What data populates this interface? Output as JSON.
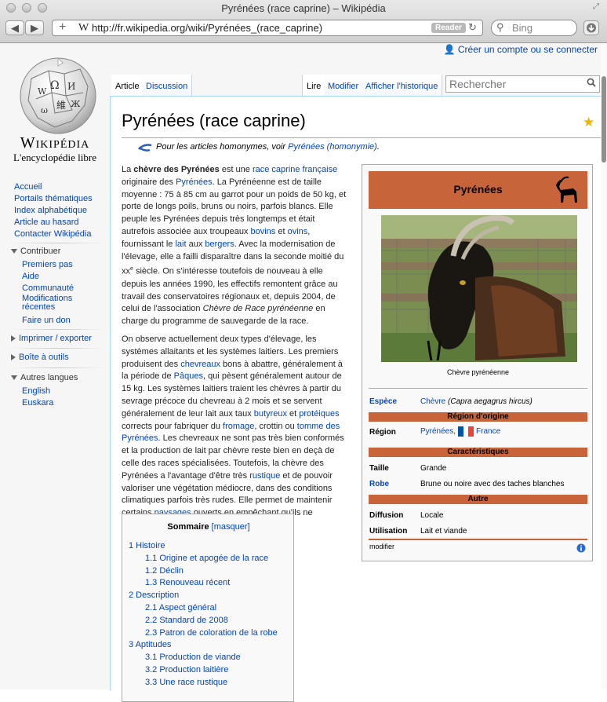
{
  "browser": {
    "window_title": "Pyrénées (race caprine) – Wikipédia",
    "url": "http://fr.wikipedia.org/wiki/Pyrénées_(race_caprine)",
    "reader_label": "Reader",
    "search_placeholder": "Bing"
  },
  "logo": {
    "title": "Wikipédia",
    "subtitle": "L'encyclopédie libre"
  },
  "sidebar": {
    "nav": [
      "Accueil",
      "Portails thématiques",
      "Index alphabétique",
      "Article au hasard",
      "Contacter Wikipédia"
    ],
    "contribuer": {
      "label": "Contribuer",
      "items": [
        "Premiers pas",
        "Aide",
        "Communauté",
        "Modifications récentes",
        "Faire un don"
      ]
    },
    "imprimer": "Imprimer / exporter",
    "outils": "Boîte à outils",
    "langues": {
      "label": "Autres langues",
      "items": [
        "English",
        "Euskara"
      ]
    }
  },
  "personal": {
    "create_account": "Créer un compte ou se connecter"
  },
  "tabs": {
    "article": "Article",
    "discussion": "Discussion",
    "lire": "Lire",
    "modifier": "Modifier",
    "historique": "Afficher l'historique"
  },
  "search": {
    "placeholder": "Rechercher"
  },
  "article": {
    "title": "Pyrénées (race caprine)",
    "hatnote_prefix": "Pour les articles homonymes, voir ",
    "hatnote_link": "Pyrénées (homonymie)",
    "hatnote_suffix": "."
  },
  "infobox": {
    "title": "Pyrénées",
    "caption": "Chèvre pyrénéenne",
    "espece_label": "Espèce",
    "espece_link": "Chèvre",
    "espece_sci": "(Capra aegagrus hircus)",
    "region_head": "Région d'origine",
    "region_label": "Région",
    "region_link": "Pyrénées,",
    "region_country": "France",
    "carac_head": "Caractéristiques",
    "taille_label": "Taille",
    "taille_val": "Grande",
    "robe_label": "Robe",
    "robe_val": "Brune ou noire avec des taches blanches",
    "autre_head": "Autre",
    "diffusion_label": "Diffusion",
    "diffusion_val": "Locale",
    "utilisation_label": "Utilisation",
    "utilisation_val": "Lait et viande",
    "modifier": "modifier"
  },
  "toc": {
    "title": "Sommaire",
    "toggle": "[masquer]",
    "items": [
      {
        "num": "1",
        "text": "Histoire"
      },
      {
        "num": "1.1",
        "text": "Origine et apogée de la race"
      },
      {
        "num": "1.2",
        "text": "Déclin"
      },
      {
        "num": "1.3",
        "text": "Renouveau récent"
      },
      {
        "num": "2",
        "text": "Description"
      },
      {
        "num": "2.1",
        "text": "Aspect général"
      },
      {
        "num": "2.2",
        "text": "Standard de 2008"
      },
      {
        "num": "2.3",
        "text": "Patron de coloration de la robe"
      },
      {
        "num": "3",
        "text": "Aptitudes"
      },
      {
        "num": "3.1",
        "text": "Production de viande"
      },
      {
        "num": "3.2",
        "text": "Production laitière"
      },
      {
        "num": "3.3",
        "text": "Une race rustique"
      }
    ]
  },
  "colors": {
    "link": "#0645ad",
    "infobox_header": "#c8643a",
    "border": "#a7d7f9"
  }
}
